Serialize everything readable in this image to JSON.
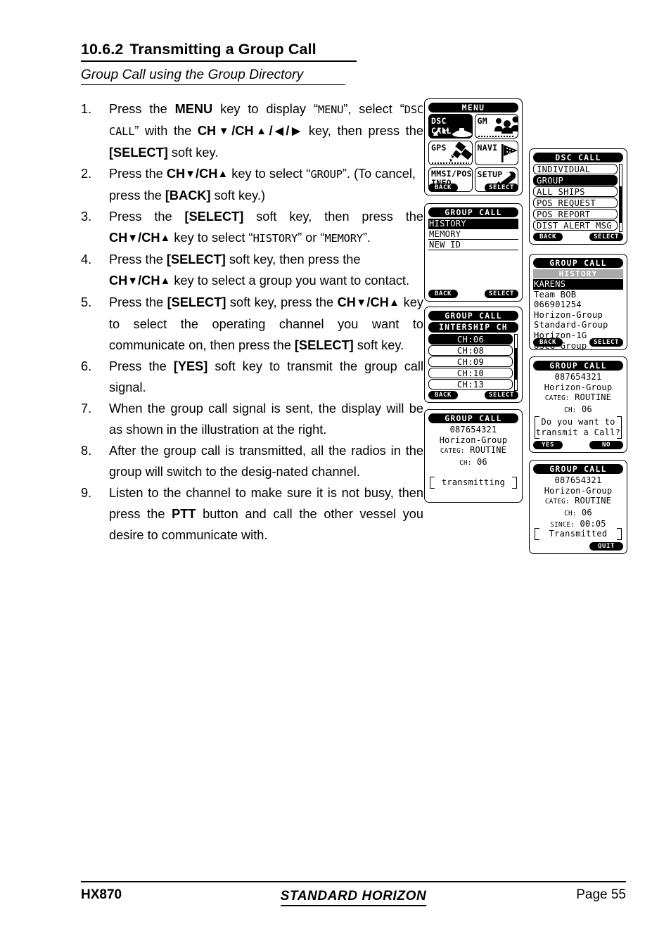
{
  "section": {
    "number": "10.6.2",
    "title": "Transmitting a Group Call",
    "subtitle": "Group Call using the Group Directory"
  },
  "steps": [
    {
      "num": "1.",
      "text": "Press the MENU key to display “MENU”, select “DSC CALL” with the CH▼/CH▲/◀/▶ key, then press the [SELECT] soft key."
    },
    {
      "num": "2.",
      "text": "Press the CH▼/CH▲ key to select “GROUP”. (To cancel, press the [BACK] soft key.)"
    },
    {
      "num": "3.",
      "text": "Press the [SELECT] soft key, then press the CH▼/CH▲ key to select “HISTORY” or “MEMORY”."
    },
    {
      "num": "4.",
      "text": "Press the [SELECT] soft key, then press the CH▼/CH▲ key to select a group you want to contact."
    },
    {
      "num": "5.",
      "text": "Press the [SELECT] soft key, press the CH▼/CH▲ key to select the operating channel you want to communicate on, then press the [SELECT] soft key."
    },
    {
      "num": "6.",
      "text": "Press the [YES] soft key to transmit the group call signal."
    },
    {
      "num": "7.",
      "text": "When the group call signal is sent, the display will be as shown in the illustration at the right."
    },
    {
      "num": "8.",
      "text": "After the group call is transmitted, all the radios in the group will switch to the designated channel."
    },
    {
      "num": "9.",
      "text": "Listen to the channel to make sure it is not busy, then press the PTT button and call the other vessel you desire to communicate with."
    }
  ],
  "screens": {
    "menu": {
      "title": "MENU",
      "tiles": [
        {
          "label": "DSC CALL",
          "icon": "antenna-boat-icon",
          "selected": true
        },
        {
          "label": "GM",
          "icon": "group-people-icon",
          "selected": false
        },
        {
          "label": "GPS",
          "icon": "satellite-icon",
          "selected": false
        },
        {
          "label": "NAVI",
          "icon": "flag-icon",
          "selected": false
        },
        {
          "label": "MMSI/POS INFO",
          "label_line1": "MMSI/POS",
          "label_line2": "INFO",
          "icon": "info-icon",
          "selected": false
        },
        {
          "label": "SETUP",
          "icon": "wrench-icon",
          "selected": false
        }
      ],
      "soft_left": "BACK",
      "soft_right": "SELECT"
    },
    "dsc_call": {
      "title": "DSC CALL",
      "items": [
        {
          "label": "INDIVIDUAL",
          "selected": false
        },
        {
          "label": "GROUP",
          "selected": true
        },
        {
          "label": "ALL SHIPS",
          "selected": false
        },
        {
          "label": "POS REQUEST",
          "selected": false
        },
        {
          "label": "POS REPORT",
          "selected": false
        },
        {
          "label": "DIST ALERT MSG",
          "selected": false
        }
      ],
      "soft_left": "BACK",
      "soft_right": "SELECT"
    },
    "group_call_src": {
      "title": "GROUP CALL",
      "items": [
        {
          "label": "HISTORY",
          "selected": true
        },
        {
          "label": "MEMORY",
          "selected": false
        },
        {
          "label": "NEW ID",
          "selected": false
        }
      ],
      "soft_left": "BACK",
      "soft_right": "SELECT"
    },
    "group_history": {
      "title": "GROUP CALL",
      "subtitle": "HISTORY",
      "items": [
        {
          "label": "KARENS",
          "selected": true
        },
        {
          "label": "Team BOB",
          "selected": false
        },
        {
          "label": "066901254",
          "selected": false
        },
        {
          "label": "Horizon-Group",
          "selected": false
        },
        {
          "label": "Standard-Group",
          "selected": false
        },
        {
          "label": "Horizon-1G",
          "selected": false
        },
        {
          "label": "USCG Group",
          "selected": false
        }
      ],
      "soft_left": "BACK",
      "soft_right": "SELECT"
    },
    "intership_ch": {
      "title": "GROUP CALL",
      "subtitle": "INTERSHIP CH",
      "items": [
        {
          "label": "CH:06",
          "selected": true
        },
        {
          "label": "CH:08",
          "selected": false
        },
        {
          "label": "CH:09",
          "selected": false
        },
        {
          "label": "CH:10",
          "selected": false
        },
        {
          "label": "CH:13",
          "selected": false
        }
      ],
      "soft_left": "BACK",
      "soft_right": "SELECT"
    },
    "confirm": {
      "title": "GROUP CALL",
      "mmsi": "087654321",
      "group_name": "Horizon-Group",
      "categ_label": "CATEG:",
      "categ_value": "ROUTINE",
      "ch_label": "CH:",
      "ch_value": "06",
      "message_line1": "Do you want to",
      "message_line2": "transmit a Call?",
      "soft_left": "YES",
      "soft_right": "NO"
    },
    "transmitting": {
      "title": "GROUP CALL",
      "mmsi": "087654321",
      "group_name": "Horizon-Group",
      "categ_label": "CATEG:",
      "categ_value": "ROUTINE",
      "ch_label": "CH:",
      "ch_value": "06",
      "message": "transmitting"
    },
    "transmitted": {
      "title": "GROUP CALL",
      "mmsi": "087654321",
      "group_name": "Horizon-Group",
      "categ_label": "CATEG:",
      "categ_value": "ROUTINE",
      "ch_label": "CH:",
      "ch_value": "06",
      "since_label": "SINCE:",
      "since_value": "00:05",
      "message": "Transmitted",
      "soft_right": "QUIT"
    }
  },
  "footer": {
    "model": "HX870",
    "brand": "STANDARD HORIZON",
    "page": "Page 55"
  }
}
